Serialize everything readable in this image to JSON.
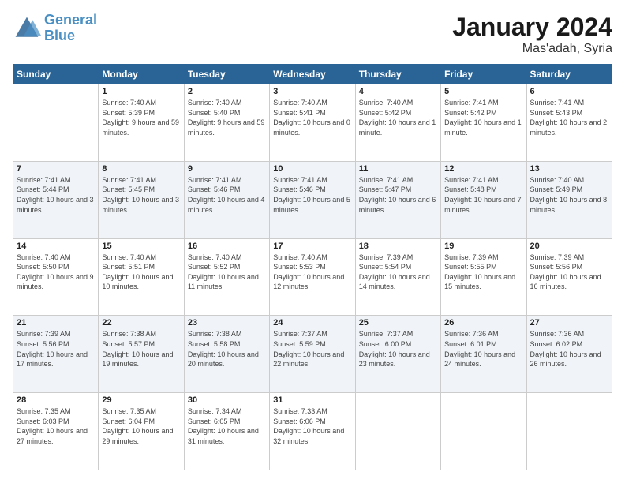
{
  "header": {
    "logo_line1": "General",
    "logo_line2": "Blue",
    "month": "January 2024",
    "location": "Mas'adah, Syria"
  },
  "weekdays": [
    "Sunday",
    "Monday",
    "Tuesday",
    "Wednesday",
    "Thursday",
    "Friday",
    "Saturday"
  ],
  "weeks": [
    [
      {
        "day": null,
        "sunrise": null,
        "sunset": null,
        "daylight": null
      },
      {
        "day": "1",
        "sunrise": "Sunrise: 7:40 AM",
        "sunset": "Sunset: 5:39 PM",
        "daylight": "Daylight: 9 hours and 59 minutes."
      },
      {
        "day": "2",
        "sunrise": "Sunrise: 7:40 AM",
        "sunset": "Sunset: 5:40 PM",
        "daylight": "Daylight: 9 hours and 59 minutes."
      },
      {
        "day": "3",
        "sunrise": "Sunrise: 7:40 AM",
        "sunset": "Sunset: 5:41 PM",
        "daylight": "Daylight: 10 hours and 0 minutes."
      },
      {
        "day": "4",
        "sunrise": "Sunrise: 7:40 AM",
        "sunset": "Sunset: 5:42 PM",
        "daylight": "Daylight: 10 hours and 1 minute."
      },
      {
        "day": "5",
        "sunrise": "Sunrise: 7:41 AM",
        "sunset": "Sunset: 5:42 PM",
        "daylight": "Daylight: 10 hours and 1 minute."
      },
      {
        "day": "6",
        "sunrise": "Sunrise: 7:41 AM",
        "sunset": "Sunset: 5:43 PM",
        "daylight": "Daylight: 10 hours and 2 minutes."
      }
    ],
    [
      {
        "day": "7",
        "sunrise": "Sunrise: 7:41 AM",
        "sunset": "Sunset: 5:44 PM",
        "daylight": "Daylight: 10 hours and 3 minutes."
      },
      {
        "day": "8",
        "sunrise": "Sunrise: 7:41 AM",
        "sunset": "Sunset: 5:45 PM",
        "daylight": "Daylight: 10 hours and 3 minutes."
      },
      {
        "day": "9",
        "sunrise": "Sunrise: 7:41 AM",
        "sunset": "Sunset: 5:46 PM",
        "daylight": "Daylight: 10 hours and 4 minutes."
      },
      {
        "day": "10",
        "sunrise": "Sunrise: 7:41 AM",
        "sunset": "Sunset: 5:46 PM",
        "daylight": "Daylight: 10 hours and 5 minutes."
      },
      {
        "day": "11",
        "sunrise": "Sunrise: 7:41 AM",
        "sunset": "Sunset: 5:47 PM",
        "daylight": "Daylight: 10 hours and 6 minutes."
      },
      {
        "day": "12",
        "sunrise": "Sunrise: 7:41 AM",
        "sunset": "Sunset: 5:48 PM",
        "daylight": "Daylight: 10 hours and 7 minutes."
      },
      {
        "day": "13",
        "sunrise": "Sunrise: 7:40 AM",
        "sunset": "Sunset: 5:49 PM",
        "daylight": "Daylight: 10 hours and 8 minutes."
      }
    ],
    [
      {
        "day": "14",
        "sunrise": "Sunrise: 7:40 AM",
        "sunset": "Sunset: 5:50 PM",
        "daylight": "Daylight: 10 hours and 9 minutes."
      },
      {
        "day": "15",
        "sunrise": "Sunrise: 7:40 AM",
        "sunset": "Sunset: 5:51 PM",
        "daylight": "Daylight: 10 hours and 10 minutes."
      },
      {
        "day": "16",
        "sunrise": "Sunrise: 7:40 AM",
        "sunset": "Sunset: 5:52 PM",
        "daylight": "Daylight: 10 hours and 11 minutes."
      },
      {
        "day": "17",
        "sunrise": "Sunrise: 7:40 AM",
        "sunset": "Sunset: 5:53 PM",
        "daylight": "Daylight: 10 hours and 12 minutes."
      },
      {
        "day": "18",
        "sunrise": "Sunrise: 7:39 AM",
        "sunset": "Sunset: 5:54 PM",
        "daylight": "Daylight: 10 hours and 14 minutes."
      },
      {
        "day": "19",
        "sunrise": "Sunrise: 7:39 AM",
        "sunset": "Sunset: 5:55 PM",
        "daylight": "Daylight: 10 hours and 15 minutes."
      },
      {
        "day": "20",
        "sunrise": "Sunrise: 7:39 AM",
        "sunset": "Sunset: 5:56 PM",
        "daylight": "Daylight: 10 hours and 16 minutes."
      }
    ],
    [
      {
        "day": "21",
        "sunrise": "Sunrise: 7:39 AM",
        "sunset": "Sunset: 5:56 PM",
        "daylight": "Daylight: 10 hours and 17 minutes."
      },
      {
        "day": "22",
        "sunrise": "Sunrise: 7:38 AM",
        "sunset": "Sunset: 5:57 PM",
        "daylight": "Daylight: 10 hours and 19 minutes."
      },
      {
        "day": "23",
        "sunrise": "Sunrise: 7:38 AM",
        "sunset": "Sunset: 5:58 PM",
        "daylight": "Daylight: 10 hours and 20 minutes."
      },
      {
        "day": "24",
        "sunrise": "Sunrise: 7:37 AM",
        "sunset": "Sunset: 5:59 PM",
        "daylight": "Daylight: 10 hours and 22 minutes."
      },
      {
        "day": "25",
        "sunrise": "Sunrise: 7:37 AM",
        "sunset": "Sunset: 6:00 PM",
        "daylight": "Daylight: 10 hours and 23 minutes."
      },
      {
        "day": "26",
        "sunrise": "Sunrise: 7:36 AM",
        "sunset": "Sunset: 6:01 PM",
        "daylight": "Daylight: 10 hours and 24 minutes."
      },
      {
        "day": "27",
        "sunrise": "Sunrise: 7:36 AM",
        "sunset": "Sunset: 6:02 PM",
        "daylight": "Daylight: 10 hours and 26 minutes."
      }
    ],
    [
      {
        "day": "28",
        "sunrise": "Sunrise: 7:35 AM",
        "sunset": "Sunset: 6:03 PM",
        "daylight": "Daylight: 10 hours and 27 minutes."
      },
      {
        "day": "29",
        "sunrise": "Sunrise: 7:35 AM",
        "sunset": "Sunset: 6:04 PM",
        "daylight": "Daylight: 10 hours and 29 minutes."
      },
      {
        "day": "30",
        "sunrise": "Sunrise: 7:34 AM",
        "sunset": "Sunset: 6:05 PM",
        "daylight": "Daylight: 10 hours and 31 minutes."
      },
      {
        "day": "31",
        "sunrise": "Sunrise: 7:33 AM",
        "sunset": "Sunset: 6:06 PM",
        "daylight": "Daylight: 10 hours and 32 minutes."
      },
      {
        "day": null,
        "sunrise": null,
        "sunset": null,
        "daylight": null
      },
      {
        "day": null,
        "sunrise": null,
        "sunset": null,
        "daylight": null
      },
      {
        "day": null,
        "sunrise": null,
        "sunset": null,
        "daylight": null
      }
    ]
  ]
}
